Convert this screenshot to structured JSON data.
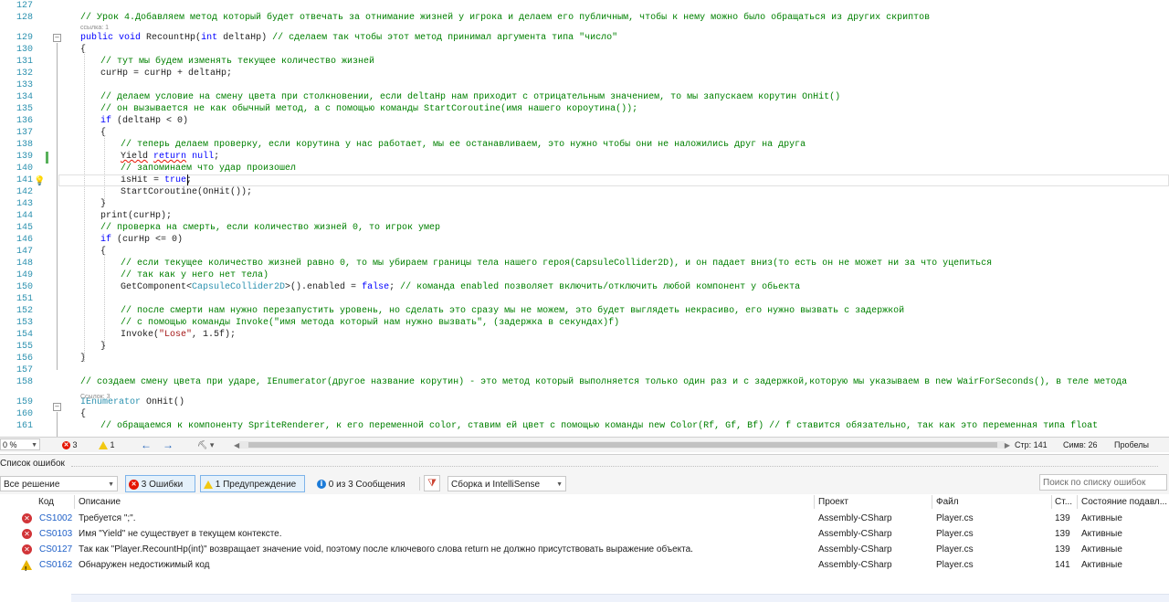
{
  "editor": {
    "lines": [
      {
        "n": "127",
        "segs": []
      },
      {
        "n": "128",
        "segs": [
          {
            "c": "cm",
            "t": "// Урок 4.Добавляем метод который будет отвечать за отнимание жизней у игрока и делаем его публичным, чтобы к нему можно было обращаться из других скриптов"
          }
        ]
      },
      {
        "n": "129",
        "segs": [
          {
            "c": "kw",
            "t": "public"
          },
          {
            "c": "",
            "t": " "
          },
          {
            "c": "kw",
            "t": "void"
          },
          {
            "c": "",
            "t": " RecountHp("
          },
          {
            "c": "kw",
            "t": "int"
          },
          {
            "c": "",
            "t": " deltaHp) "
          },
          {
            "c": "cm",
            "t": "// сделаем так чтобы этот метод принимал аргумента типа \"число\""
          }
        ]
      },
      {
        "n": "130",
        "segs": [
          {
            "c": "",
            "t": "{"
          }
        ]
      },
      {
        "n": "131",
        "segs": [
          {
            "c": "cm",
            "t": "// тут мы будем изменять текущее количество жизней"
          }
        ]
      },
      {
        "n": "132",
        "segs": [
          {
            "c": "",
            "t": "curHp = curHp + deltaHp;"
          }
        ]
      },
      {
        "n": "133",
        "segs": []
      },
      {
        "n": "134",
        "segs": [
          {
            "c": "cm",
            "t": "// делаем условие на смену цвета при столкновении, если deltaHp нам приходит с отрицательным значением, то мы запускаем корутин OnHit()"
          }
        ]
      },
      {
        "n": "135",
        "segs": [
          {
            "c": "cm",
            "t": "// он вызывается не как обычный метод, а с помощью команды StartCoroutine(имя нашего короутина());"
          }
        ]
      },
      {
        "n": "136",
        "segs": [
          {
            "c": "kw",
            "t": "if"
          },
          {
            "c": "",
            "t": " (deltaHp < 0)"
          }
        ]
      },
      {
        "n": "137",
        "segs": [
          {
            "c": "",
            "t": "{"
          }
        ]
      },
      {
        "n": "138",
        "segs": [
          {
            "c": "cm",
            "t": "// теперь делаем проверку, если корутина у нас работает, мы ее останавливаем, это нужно чтобы они не наложились друг на друга"
          }
        ]
      },
      {
        "n": "139",
        "segs": [
          {
            "c": "sq",
            "t": "Yield"
          },
          {
            "c": "",
            "t": " "
          },
          {
            "c": "kw sq",
            "t": "return"
          },
          {
            "c": "",
            "t": " "
          },
          {
            "c": "kw",
            "t": "null"
          },
          {
            "c": "",
            "t": ";"
          }
        ]
      },
      {
        "n": "140",
        "segs": [
          {
            "c": "cm",
            "t": "// запоминаем что удар произошел"
          }
        ]
      },
      {
        "n": "141",
        "segs": [
          {
            "c": "",
            "t": "isHit = "
          },
          {
            "c": "kw",
            "t": "true"
          },
          {
            "c": "",
            "t": ";"
          }
        ]
      },
      {
        "n": "142",
        "segs": [
          {
            "c": "",
            "t": "StartCoroutine(OnHit());"
          }
        ]
      },
      {
        "n": "143",
        "segs": [
          {
            "c": "",
            "t": "}"
          }
        ]
      },
      {
        "n": "144",
        "segs": [
          {
            "c": "",
            "t": "print(curHp);"
          }
        ]
      },
      {
        "n": "145",
        "segs": [
          {
            "c": "cm",
            "t": "// проверка на смерть, если количество жизней 0, то игрок умер"
          }
        ]
      },
      {
        "n": "146",
        "segs": [
          {
            "c": "kw",
            "t": "if"
          },
          {
            "c": "",
            "t": " (curHp <= 0)"
          }
        ]
      },
      {
        "n": "147",
        "segs": [
          {
            "c": "",
            "t": "{"
          }
        ]
      },
      {
        "n": "148",
        "segs": [
          {
            "c": "cm",
            "t": "// если текущее количество жизней равно 0, то мы убираем границы тела нашего героя(CapsuleCollider2D), и он падает вниз(то есть он не может ни за что уцепиться"
          }
        ]
      },
      {
        "n": "149",
        "segs": [
          {
            "c": "cm",
            "t": "// так как у него нет тела)"
          }
        ]
      },
      {
        "n": "150",
        "segs": [
          {
            "c": "",
            "t": "GetComponent<"
          },
          {
            "c": "ty",
            "t": "CapsuleCollider2D"
          },
          {
            "c": "",
            "t": ">().enabled = "
          },
          {
            "c": "kw",
            "t": "false"
          },
          {
            "c": "",
            "t": "; "
          },
          {
            "c": "cm",
            "t": "// команда enabled позволяет включить/отключить любой компонент у обьекта"
          }
        ]
      },
      {
        "n": "151",
        "segs": []
      },
      {
        "n": "152",
        "segs": [
          {
            "c": "cm",
            "t": "// после смерти нам нужно перезапустить уровень, но сделать это сразу мы не можем, это будет выглядеть некрасиво, его нужно вызвать с задержкой"
          }
        ]
      },
      {
        "n": "153",
        "segs": [
          {
            "c": "cm",
            "t": "// с помощью команды Invoke(\"имя метода который нам нужно вызвать\", (задержка в секундах)f)"
          }
        ]
      },
      {
        "n": "154",
        "segs": [
          {
            "c": "",
            "t": "Invoke("
          },
          {
            "c": "st",
            "t": "\"Lose\""
          },
          {
            "c": "",
            "t": ", 1.5f);"
          }
        ]
      },
      {
        "n": "155",
        "segs": [
          {
            "c": "",
            "t": "}"
          }
        ]
      },
      {
        "n": "156",
        "segs": [
          {
            "c": "",
            "t": "}"
          }
        ]
      },
      {
        "n": "157",
        "segs": []
      },
      {
        "n": "158",
        "segs": [
          {
            "c": "cm",
            "t": "// создаем смену цвета при ударе, IEnumerator(другое название корутин) - это метод который выполняется только один раз и с задержкой,которую мы указываем в new WairForSeconds(), в теле метода"
          }
        ]
      },
      {
        "n": "159",
        "segs": [
          {
            "c": "ty",
            "t": "IEnumerator"
          },
          {
            "c": "",
            "t": " OnHit()"
          }
        ]
      },
      {
        "n": "160",
        "segs": [
          {
            "c": "",
            "t": "{"
          }
        ]
      },
      {
        "n": "161",
        "segs": [
          {
            "c": "cm",
            "t": "// обращаемся к компоненту SpriteRenderer, к его переменной color, ставим ей цвет с помощью команды new Color(Rf, Gf, Bf) // f ставится обязательно, так как это переменная типа float"
          }
        ]
      }
    ],
    "ref_hints": [
      "ссылка: 1",
      "Ссылок: 3"
    ]
  },
  "statusbar": {
    "zoom": "0 %",
    "errors": "3",
    "warnings": "1",
    "position": "Стр: 141",
    "column": "Симв: 26",
    "whitespace": "Пробелы"
  },
  "error_list": {
    "title": "Список ошибок",
    "scope": "Все решение",
    "errors_btn": "3 Ошибки",
    "warnings_btn": "1 Предупреждение",
    "messages_btn": "0 из 3 Сообщения",
    "source": "Сборка и IntelliSense",
    "search_placeholder": "Поиск по списку ошибок",
    "columns": [
      "Код",
      "Описание",
      "Проект",
      "Файл",
      "Ст...",
      "Состояние подавл..."
    ],
    "rows": [
      {
        "kind": "error",
        "code": "CS1002",
        "desc": "Требуется \";\".",
        "project": "Assembly-CSharp",
        "file": "Player.cs",
        "line": "139",
        "state": "Активные"
      },
      {
        "kind": "error",
        "code": "CS0103",
        "desc": "Имя \"Yield\" не существует в текущем контексте.",
        "project": "Assembly-CSharp",
        "file": "Player.cs",
        "line": "139",
        "state": "Активные"
      },
      {
        "kind": "error",
        "code": "CS0127",
        "desc": "Так как \"Player.RecountHp(int)\" возвращает значение void, поэтому после ключевого слова return не должно присутствовать выражение объекта.",
        "project": "Assembly-CSharp",
        "file": "Player.cs",
        "line": "139",
        "state": "Активные"
      },
      {
        "kind": "warning",
        "code": "CS0162",
        "desc": "Обнаружен недостижимый код",
        "project": "Assembly-CSharp",
        "file": "Player.cs",
        "line": "141",
        "state": "Активные"
      }
    ]
  }
}
